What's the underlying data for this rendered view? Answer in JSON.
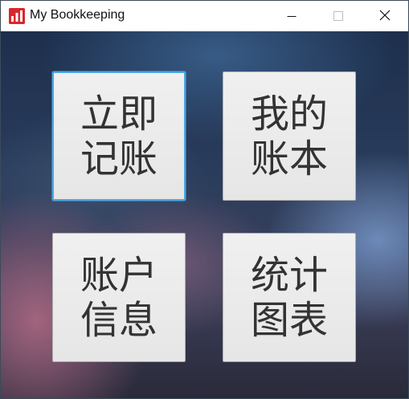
{
  "window": {
    "title": "My Bookkeeping",
    "app_icon": "bar-chart-icon",
    "controls": {
      "minimize_icon": "minimize-icon",
      "maximize_icon": "maximize-icon",
      "close_icon": "close-icon"
    }
  },
  "main": {
    "tiles": [
      {
        "label": "立即记账",
        "focused": true
      },
      {
        "label": "我的账本",
        "focused": false
      },
      {
        "label": "账户信息",
        "focused": false
      },
      {
        "label": "统计图表",
        "focused": false
      }
    ]
  },
  "colors": {
    "app_icon_bg": "#d9262b",
    "focus_border": "#4aa8e6",
    "tile_text": "#333333"
  }
}
